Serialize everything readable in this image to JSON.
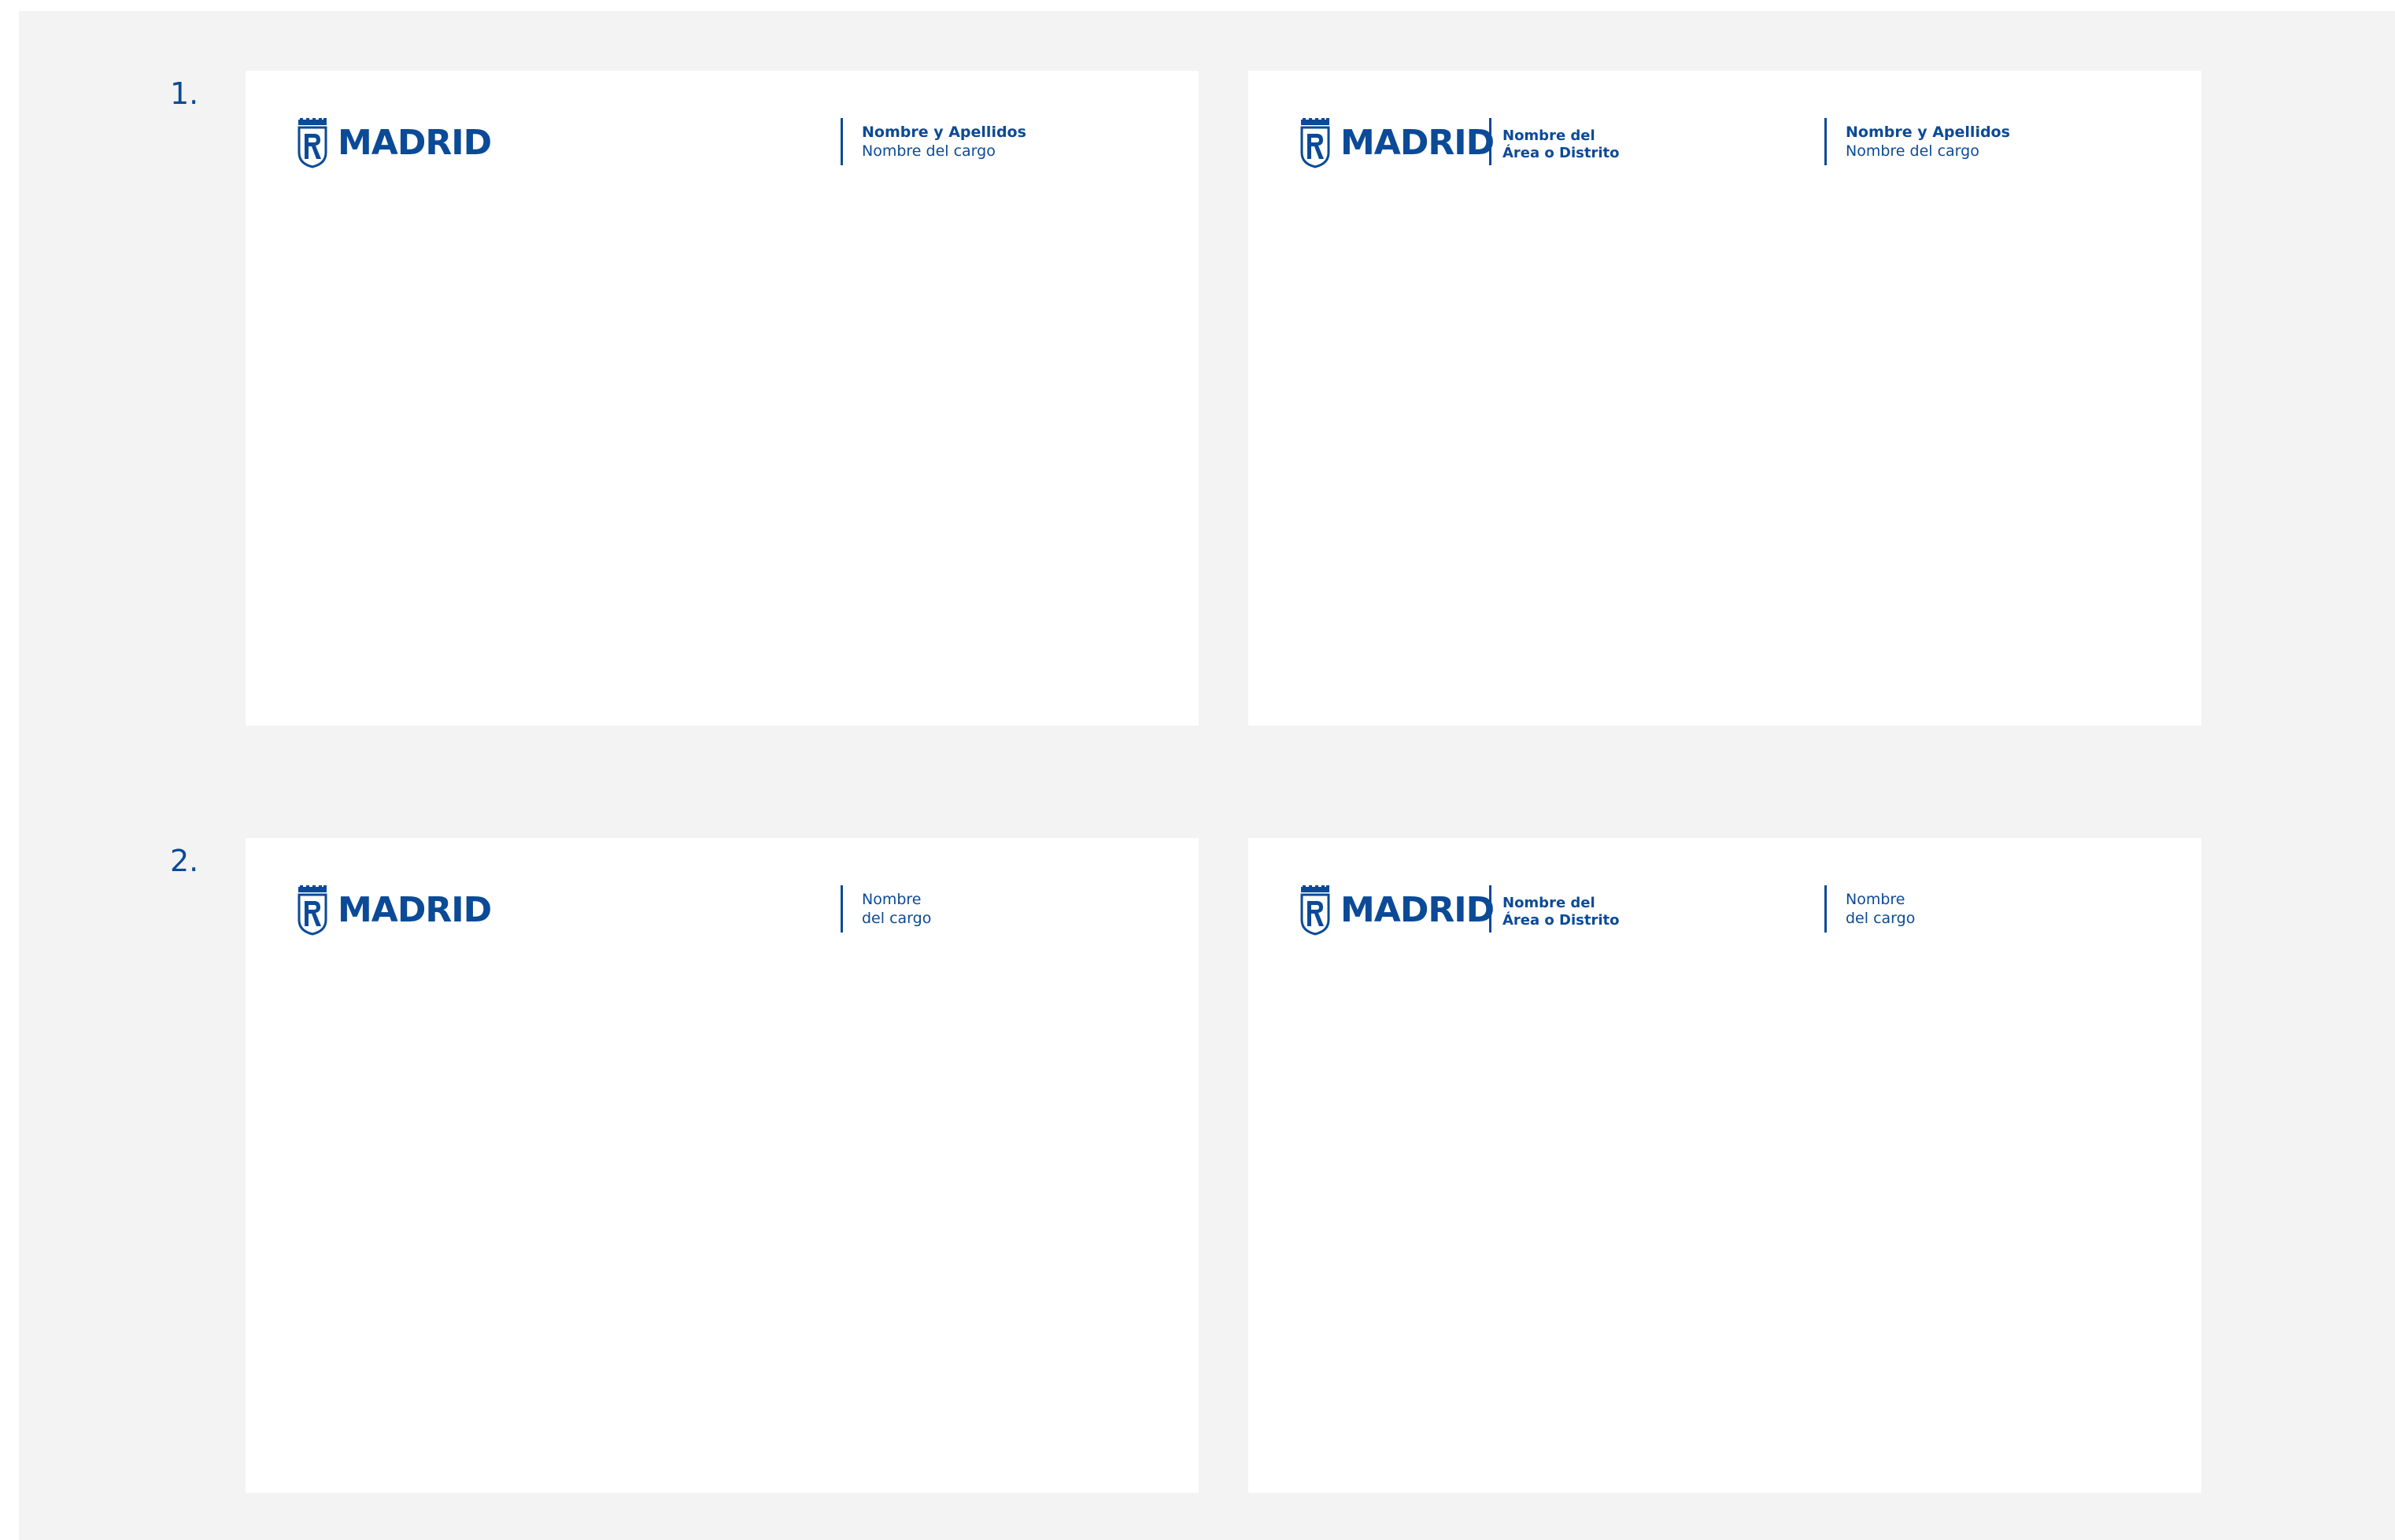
{
  "brand": {
    "color": "#0b4a97",
    "wordmark": "MADRID",
    "emblem_icon": "madrid-shield-emblem"
  },
  "rows": [
    {
      "number": "1.",
      "cards": [
        {
          "area": null,
          "person_name": "Nombre y Apellidos",
          "position_title": "Nombre del cargo"
        },
        {
          "area_line_1": "Nombre del",
          "area_line_2": "Área o Distrito",
          "person_name": "Nombre y Apellidos",
          "position_title": "Nombre del cargo"
        }
      ]
    },
    {
      "number": "2.",
      "cards": [
        {
          "position_line_1": "Nombre",
          "position_line_2": "del cargo"
        },
        {
          "area_line_1": "Nombre del",
          "area_line_2": "Área o Distrito",
          "position_line_1": "Nombre",
          "position_line_2": "del cargo"
        }
      ]
    }
  ]
}
